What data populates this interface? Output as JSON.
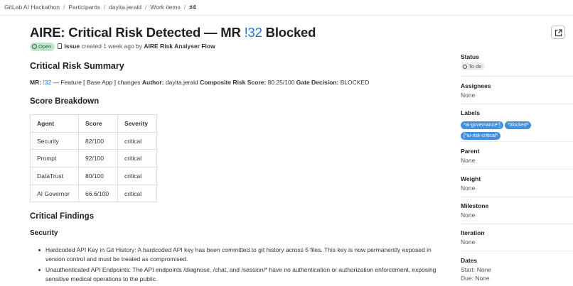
{
  "breadcrumbs": {
    "items": [
      "GitLab AI Hackathon",
      "Participants",
      "dayita.jerald",
      "Work items",
      "#4"
    ],
    "separator": "/"
  },
  "issue": {
    "title_prefix": "AIRE: Critical Risk Detected — MR ",
    "title_mr": "!32",
    "title_suffix": " Blocked",
    "state": "Open",
    "type": "Issue",
    "created": "created 1 week ago by",
    "author": "AIRE Risk Analyser Flow",
    "edit_icon": "external-link-icon"
  },
  "body": {
    "summary_heading": "Critical Risk Summary",
    "summary": {
      "mr_label": "MR:",
      "mr_value": "!32",
      "feature_text": "— Feature [ Base App ] changes",
      "author_label": "Author:",
      "author_value": "dayita.jerald",
      "score_label": "Composite Risk Score:",
      "score_value": "80.25/100",
      "gate_label": "Gate Decision:",
      "gate_value": "BLOCKED"
    },
    "breakdown_heading": "Score Breakdown",
    "table": {
      "headers": [
        "Agent",
        "Score",
        "Severity"
      ],
      "rows": [
        [
          "Security",
          "82/100",
          "critical"
        ],
        [
          "Prompt",
          "92/100",
          "critical"
        ],
        [
          "DataTrust",
          "80/100",
          "critical"
        ],
        [
          "AI Governor",
          "66.6/100",
          "critical"
        ]
      ]
    },
    "findings_heading": "Critical Findings",
    "security_heading": "Security",
    "findings": [
      "Hardcoded API Key in Git History: A hardcoded API key has been committed to git history across 5 files. This key is now permanently exposed in version control and must be treated as compromised.",
      "Unauthenticated API Endpoints: The API endpoints /diagnose, /chat, and /session/* have no authentication or authorization enforcement, exposing sensitive medical operations to the public."
    ]
  },
  "sidebar": {
    "status": {
      "label": "Status",
      "value": "To do"
    },
    "assignees": {
      "label": "Assignees",
      "value": "None"
    },
    "labels": {
      "label": "Labels",
      "items": [
        "*ai-governance*]",
        "*blocked*",
        "[*ai-risk-critical*"
      ],
      "color": "#428fdc"
    },
    "parent": {
      "label": "Parent",
      "value": "None"
    },
    "weight": {
      "label": "Weight",
      "value": "None"
    },
    "milestone": {
      "label": "Milestone",
      "value": "None"
    },
    "iteration": {
      "label": "Iteration",
      "value": "None"
    },
    "dates": {
      "label": "Dates",
      "start_label": "Start:",
      "start_value": "None",
      "due_label": "Due:",
      "due_value": "None"
    }
  },
  "colors": {
    "link": "#1f75cb",
    "open_badge": "#c3e6cd",
    "label": "#428fdc"
  }
}
